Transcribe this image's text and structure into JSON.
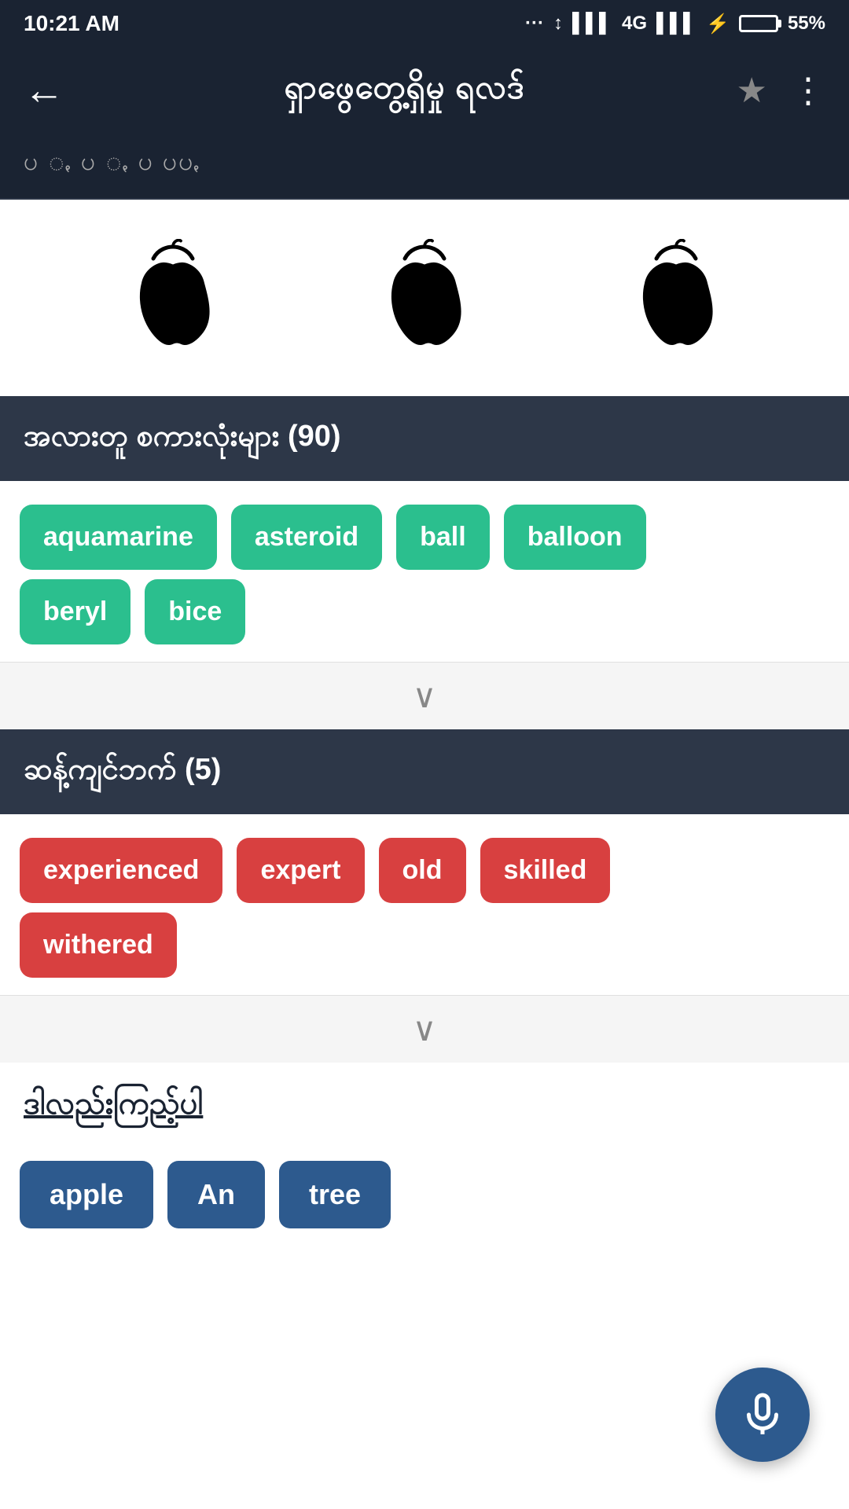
{
  "statusBar": {
    "time": "10:21 AM",
    "signal": "4G",
    "battery": "55%"
  },
  "topNav": {
    "backLabel": "←",
    "title": "ရှာဖွေတွေ့ရှိမှု ရလဒ်",
    "starLabel": "★",
    "moreLabel": "⋮"
  },
  "subtitleBar": {
    "text": "ပ  ꩻ  ပ  ꩻ  ပ           ပပꩻ"
  },
  "appleSection": {
    "icons": [
      "apple",
      "apple",
      "apple"
    ]
  },
  "relatedSection": {
    "headerText": "အလားတူ စကားလုံးများ (90)",
    "tags": [
      "aquamarine",
      "asteroid",
      "ball",
      "balloon",
      "beryl",
      "bice"
    ],
    "tagColor": "teal"
  },
  "synonymSection": {
    "headerText": "ဆန့်ကျင်ဘက် (5)",
    "tags": [
      "experienced",
      "expert",
      "old",
      "skilled",
      "withered"
    ],
    "tagColor": "red"
  },
  "alsoSection": {
    "headerText": "ဒါလည်းကြည့်ပါ"
  },
  "bottomChips": {
    "items": [
      "apple",
      "An",
      "tree"
    ]
  },
  "mic": {
    "label": "microphone"
  }
}
